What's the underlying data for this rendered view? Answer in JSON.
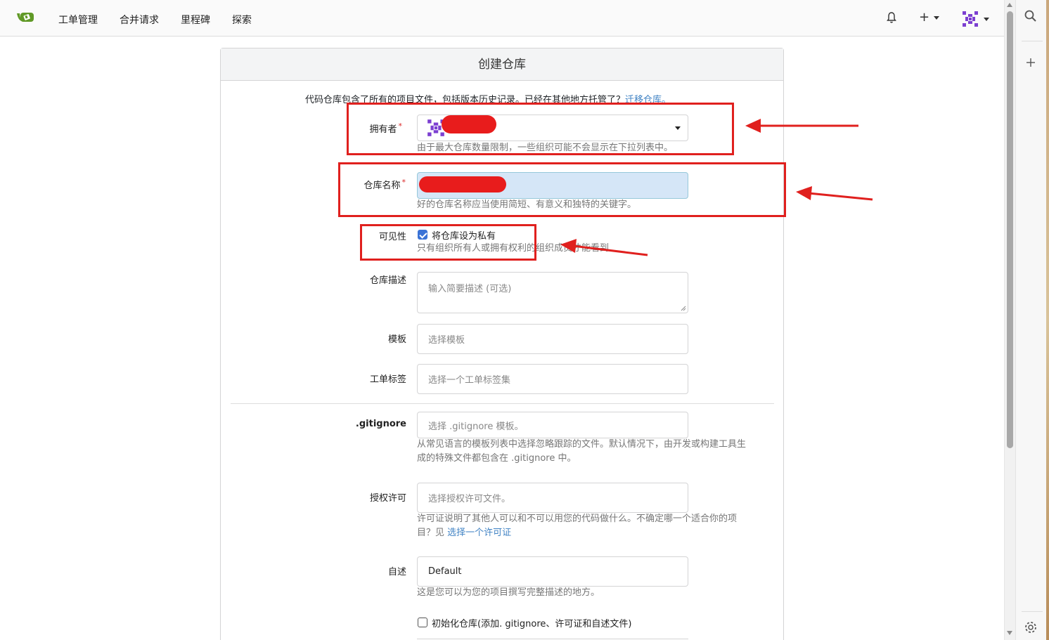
{
  "nav": {
    "links": [
      "工单管理",
      "合并请求",
      "里程碑",
      "探索"
    ],
    "bell_icon": "bell-icon",
    "plus_icon": "plus-icon",
    "avatar_icon": "avatar-icon"
  },
  "form": {
    "title": "创建仓库",
    "intro_text": "代码仓库包含了所有的项目文件，包括版本历史记录。已经在其他地方托管了？",
    "intro_link": "迁移仓库。",
    "owner": {
      "label": "拥有者",
      "required": "*",
      "help": "由于最大仓库数量限制，一些组织可能不会显示在下拉列表中。"
    },
    "repo_name": {
      "label": "仓库名称",
      "required": "*",
      "help": "好的仓库名称应当使用简短、有意义和独特的关键字。"
    },
    "visibility": {
      "label": "可见性",
      "checkbox_label": "将仓库设为私有",
      "checked": true,
      "help": "只有组织所有人或拥有权利的组织成员才能看到"
    },
    "description": {
      "label": "仓库描述",
      "placeholder": "输入简要描述 (可选)"
    },
    "template": {
      "label": "模板",
      "placeholder": "选择模板"
    },
    "issue_labels": {
      "label": "工单标签",
      "placeholder": "选择一个工单标签集"
    },
    "gitignore": {
      "label": ".gitignore",
      "placeholder": "选择 .gitignore 模板。",
      "help_line1": "从常见语言的模板列表中选择忽略跟踪的文件。默认情况下，由开发或构建工具生",
      "help_line2": "成的特殊文件都包含在 .gitignore 中。"
    },
    "license": {
      "label": "授权许可",
      "placeholder": "选择授权许可文件。",
      "help_line1": "许可证说明了其他人可以和不可以用您的代码做什么。不确定哪一个适合你的项",
      "help_line2_prefix": "目？见 ",
      "help_link": "选择一个许可证"
    },
    "readme": {
      "label": "自述",
      "value": "Default",
      "help": "这是您可以为您的项目撰写完整描述的地方。"
    },
    "init_repo": {
      "checkbox_label": "初始化仓库(添加. gitignore、许可证和自述文件)",
      "checked": false
    }
  },
  "colors": {
    "accent": "#3b73d6",
    "link": "#4183c4",
    "annotation_red": "#e0201e",
    "required_red": "#db2828",
    "logo_green": "#609926"
  }
}
